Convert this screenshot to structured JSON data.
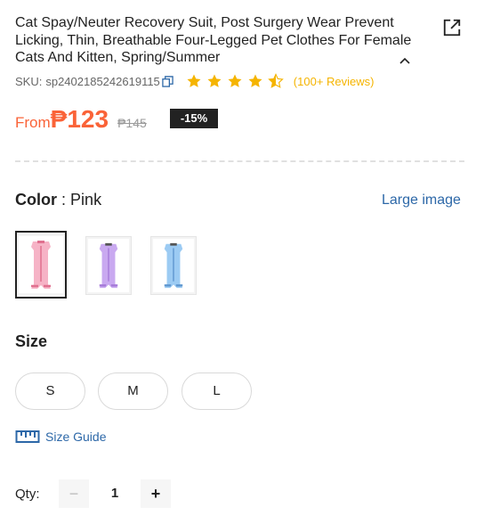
{
  "product": {
    "title": "Cat Spay/Neuter Recovery Suit, Post Surgery Wear Prevent Licking, Thin, Breathable Four-Legged Pet Clothes For Female Cats And Kitten, Spring/Summer",
    "sku_label": "SKU:",
    "sku_value": "sp2402185242619115",
    "rating": 4.5,
    "reviews": "(100+ Reviews)"
  },
  "price": {
    "from_label": "From",
    "current": "₱123",
    "original": "₱145",
    "discount": "-15%"
  },
  "color": {
    "label": "Color",
    "separator": ":",
    "selected": "Pink",
    "large_image_link": "Large image",
    "swatches": [
      {
        "name": "Pink",
        "color": "#f6b3c6",
        "accent": "#e0708f"
      },
      {
        "name": "Purple",
        "color": "#c9a9f0",
        "accent": "#a57ad8"
      },
      {
        "name": "Blue",
        "color": "#9ccbf3",
        "accent": "#5f97cf"
      }
    ]
  },
  "size": {
    "label": "Size",
    "options": [
      "S",
      "M",
      "L"
    ],
    "guide_label": "Size Guide"
  },
  "quantity": {
    "label": "Qty:",
    "minus": "−",
    "value": "1",
    "plus": "+"
  },
  "colors": {
    "accent_orange": "#fa6338",
    "link_blue": "#2d68a8",
    "star_yellow": "#f5b400"
  },
  "icons": [
    "share-icon",
    "chevron-up-icon",
    "copy-icon",
    "star-icon",
    "ruler-icon"
  ]
}
